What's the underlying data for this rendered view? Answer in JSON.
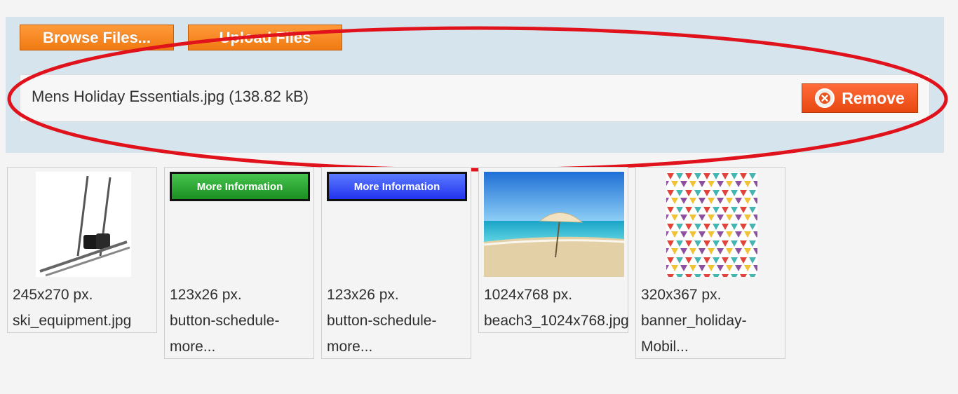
{
  "toolbar": {
    "browse_label": "Browse Files...",
    "upload_label": "Upload Files"
  },
  "selected_file": {
    "name": "Mens Holiday Essentials.jpg (138.82 kB)",
    "remove_label": "Remove"
  },
  "annotation": {
    "color": "#e0121b"
  },
  "gallery": [
    {
      "dims": "245x270 px.",
      "name_line1": "ski_equipment.jpg",
      "name_line2": "",
      "thumb": "ski-image"
    },
    {
      "dims": "123x26 px.",
      "name_line1": "button-schedule-",
      "name_line2": "more...",
      "thumb": "more-information-green",
      "thumb_text": "More Information"
    },
    {
      "dims": "123x26 px.",
      "name_line1": "button-schedule-",
      "name_line2": "more...",
      "thumb": "more-information-blue",
      "thumb_text": "More Information"
    },
    {
      "dims": "1024x768 px.",
      "name_line1": "beach3_1024x768.jpg",
      "name_line2": "",
      "thumb": "beach-image"
    },
    {
      "dims": "320x367 px.",
      "name_line1": "banner_holiday-",
      "name_line2": "Mobil...",
      "thumb": "triangle-pattern-image"
    }
  ]
}
